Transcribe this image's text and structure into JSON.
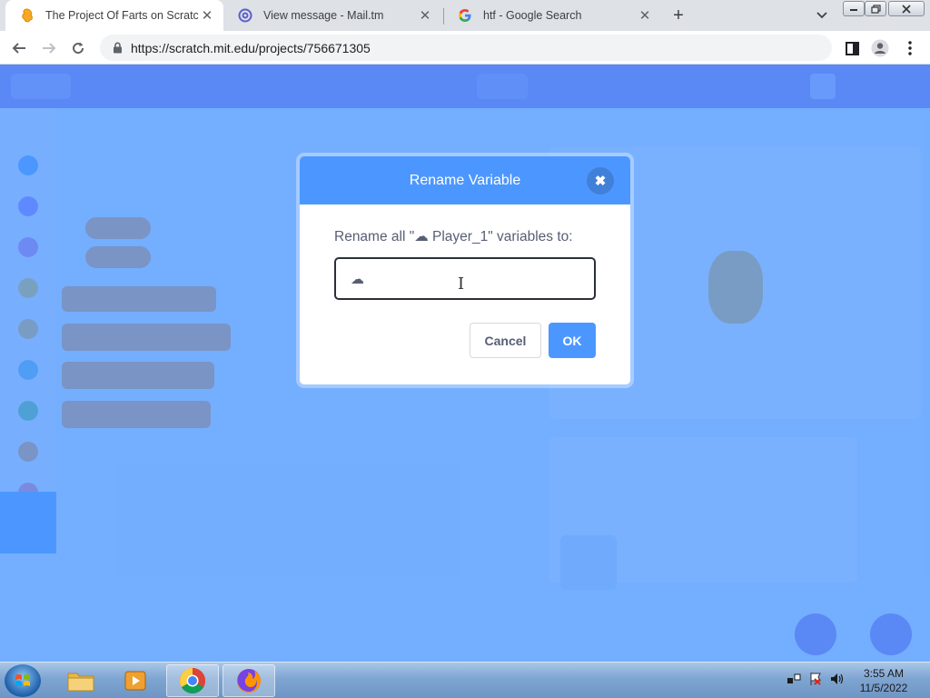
{
  "browser": {
    "tabs": [
      {
        "title": "The Project Of Farts on Scratch",
        "favicon": "scratch-favicon-icon",
        "active": true
      },
      {
        "title": "View message - Mail.tm",
        "favicon": "mailtm-favicon-icon",
        "active": false
      },
      {
        "title": "htf - Google Search",
        "favicon": "google-favicon-icon",
        "active": false
      }
    ],
    "new_tab_symbol": "+",
    "url": "https://scratch.mit.edu/projects/756671305"
  },
  "dialog": {
    "title": "Rename Variable",
    "prompt": "Rename all \"☁ Player_1\" variables to:",
    "input_value": "☁ ",
    "cancel_label": "Cancel",
    "ok_label": "OK",
    "close_symbol": "✖"
  },
  "taskbar": {
    "clock_time": "3:55 AM",
    "clock_date": "11/5/2022"
  },
  "colors": {
    "scratch_blue": "#4c97ff",
    "scratch_purple": "#855cd6",
    "dialog_text": "#575e75"
  }
}
